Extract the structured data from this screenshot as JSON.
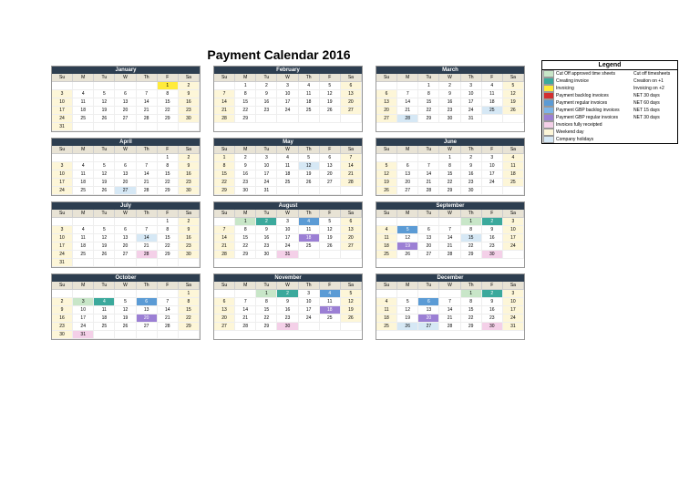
{
  "title": "Payment Calendar 2016",
  "dow": [
    "Su",
    "M",
    "Tu",
    "W",
    "Th",
    "F",
    "Sa"
  ],
  "months": [
    {
      "name": "January",
      "cells": [
        [
          "",
          "",
          "",
          "",
          "",
          "1 yl",
          "2 we"
        ],
        [
          "3 we",
          "4",
          "5",
          "6",
          "7",
          "8",
          "9 we"
        ],
        [
          "10 we",
          "11",
          "12",
          "13",
          "14",
          "15",
          "16 we"
        ],
        [
          "17 we",
          "18",
          "19",
          "20",
          "21",
          "22",
          "23 we"
        ],
        [
          "24 we",
          "25",
          "26",
          "27",
          "28",
          "29",
          "30 we"
        ],
        [
          "31 we",
          "",
          "",
          "",
          "",
          "",
          ""
        ]
      ]
    },
    {
      "name": "February",
      "cells": [
        [
          "",
          "1",
          "2",
          "3",
          "4",
          "5",
          "6 we"
        ],
        [
          "7 we",
          "8",
          "9",
          "10",
          "11",
          "12",
          "13 we"
        ],
        [
          "14 we",
          "15",
          "16",
          "17",
          "18",
          "19",
          "20 we"
        ],
        [
          "21 we",
          "22",
          "23",
          "24",
          "25",
          "26",
          "27 we"
        ],
        [
          "28 we",
          "29",
          "",
          "",
          "",
          "",
          ""
        ]
      ]
    },
    {
      "name": "March",
      "cells": [
        [
          "",
          "",
          "1",
          "2",
          "3",
          "4",
          "5 we"
        ],
        [
          "6 we",
          "7",
          "8",
          "9",
          "10",
          "11",
          "12 we"
        ],
        [
          "13 we",
          "14",
          "15",
          "16",
          "17",
          "18",
          "19 we"
        ],
        [
          "20 we",
          "21",
          "22",
          "23",
          "24",
          "25 hol",
          "26 we"
        ],
        [
          "27 we",
          "28 hol",
          "29",
          "30",
          "31",
          "",
          ""
        ]
      ]
    },
    {
      "name": "April",
      "cells": [
        [
          "",
          "",
          "",
          "",
          "",
          "1",
          "2 we"
        ],
        [
          "3 we",
          "4",
          "5",
          "6",
          "7",
          "8",
          "9 we"
        ],
        [
          "10 we",
          "11",
          "12",
          "13",
          "14",
          "15",
          "16 we"
        ],
        [
          "17 we",
          "18",
          "19",
          "20",
          "21",
          "22",
          "23 we"
        ],
        [
          "24 we",
          "25",
          "26",
          "27 hol",
          "28",
          "29",
          "30 we"
        ]
      ]
    },
    {
      "name": "May",
      "cells": [
        [
          "1 we",
          "2",
          "3",
          "4",
          "5",
          "6",
          "7 we"
        ],
        [
          "8 we",
          "9",
          "10",
          "11",
          "12 hol",
          "13",
          "14 we"
        ],
        [
          "15 we",
          "16",
          "17",
          "18",
          "19",
          "20",
          "21 we"
        ],
        [
          "22 we",
          "23",
          "24",
          "25",
          "26",
          "27",
          "28 we"
        ],
        [
          "29 we",
          "30",
          "31",
          "",
          "",
          "",
          ""
        ]
      ]
    },
    {
      "name": "June",
      "cells": [
        [
          "",
          "",
          "",
          "1",
          "2",
          "3",
          "4 we"
        ],
        [
          "5 we",
          "6",
          "7",
          "8",
          "9",
          "10",
          "11 we"
        ],
        [
          "12 we",
          "13",
          "14",
          "15",
          "16",
          "17",
          "18 we"
        ],
        [
          "19 we",
          "20",
          "21",
          "22",
          "23",
          "24",
          "25 we"
        ],
        [
          "26 we",
          "27",
          "28",
          "29",
          "30",
          "",
          ""
        ]
      ]
    },
    {
      "name": "July",
      "cells": [
        [
          "",
          "",
          "",
          "",
          "",
          "1",
          "2 we"
        ],
        [
          "3 we",
          "4",
          "5",
          "6",
          "7",
          "8",
          "9 we"
        ],
        [
          "10 we",
          "11",
          "12",
          "13",
          "14 hol",
          "15",
          "16 we"
        ],
        [
          "17 we",
          "18",
          "19",
          "20",
          "21",
          "22",
          "23 we"
        ],
        [
          "24 we",
          "25",
          "26",
          "27",
          "28 pk",
          "29",
          "30 we"
        ],
        [
          "31 we",
          "",
          "",
          "",
          "",
          "",
          ""
        ]
      ]
    },
    {
      "name": "August",
      "cells": [
        [
          "",
          "1 gr",
          "2 tl",
          "3",
          "4 bl",
          "5",
          "6 we"
        ],
        [
          "7 we",
          "8",
          "9",
          "10",
          "11",
          "12",
          "13 we"
        ],
        [
          "14 we",
          "15",
          "16",
          "17",
          "18 pu",
          "19",
          "20 we"
        ],
        [
          "21 we",
          "22",
          "23",
          "24",
          "25",
          "26",
          "27 we"
        ],
        [
          "28 we",
          "29",
          "30",
          "31 pk",
          "",
          "",
          ""
        ]
      ]
    },
    {
      "name": "September",
      "cells": [
        [
          "",
          "",
          "",
          "",
          "1 gr",
          "2 tl",
          "3 we"
        ],
        [
          "4 we",
          "5 bl",
          "6",
          "7",
          "8",
          "9",
          "10 we"
        ],
        [
          "11 we",
          "12",
          "13",
          "14",
          "15 hol",
          "16",
          "17 we"
        ],
        [
          "18 we",
          "19 pu",
          "20",
          "21",
          "22",
          "23",
          "24 we"
        ],
        [
          "25 we",
          "26",
          "27",
          "28",
          "29",
          "30 pk",
          ""
        ]
      ]
    },
    {
      "name": "October",
      "cells": [
        [
          "",
          "",
          "",
          "",
          "",
          "",
          "1 we"
        ],
        [
          "2 we",
          "3 gr",
          "4 tl",
          "5",
          "6 bl",
          "7",
          "8 we"
        ],
        [
          "9 we",
          "10",
          "11",
          "12",
          "13",
          "14",
          "15 we"
        ],
        [
          "16 we",
          "17",
          "18",
          "19",
          "20 pu",
          "21",
          "22 we"
        ],
        [
          "23 we",
          "24",
          "25",
          "26",
          "27",
          "28",
          "29 we"
        ],
        [
          "30 we",
          "31 pk",
          "",
          "",
          "",
          "",
          ""
        ]
      ]
    },
    {
      "name": "November",
      "cells": [
        [
          "",
          "",
          "1 gr",
          "2 tl",
          "3",
          "4 bl",
          "5 we"
        ],
        [
          "6 we",
          "7",
          "8",
          "9",
          "10",
          "11",
          "12 we"
        ],
        [
          "13 we",
          "14",
          "15",
          "16",
          "17",
          "18 pu",
          "19 we"
        ],
        [
          "20 we",
          "21",
          "22",
          "23",
          "24",
          "25",
          "26 we"
        ],
        [
          "27 we",
          "28",
          "29",
          "30 pk",
          "",
          "",
          ""
        ]
      ]
    },
    {
      "name": "December",
      "cells": [
        [
          "",
          "",
          "",
          "",
          "1 gr",
          "2 tl",
          "3 we"
        ],
        [
          "4 we",
          "5",
          "6 bl",
          "7",
          "8",
          "9",
          "10 we"
        ],
        [
          "11 we",
          "12",
          "13",
          "14",
          "15",
          "16",
          "17 we"
        ],
        [
          "18 we",
          "19",
          "20 pu",
          "21",
          "22",
          "23",
          "24 we"
        ],
        [
          "25 we",
          "26 hol",
          "27 hol",
          "28",
          "29",
          "30 pk",
          "31 we"
        ]
      ]
    }
  ],
  "legend": {
    "title": "Legend",
    "items": [
      {
        "c": "#c8e6c8",
        "l": "Cut Off approved time sheets",
        "r": "Cut off timesheets"
      },
      {
        "c": "#3ba99c",
        "l": "Creating invoice",
        "r": "Creation on +1"
      },
      {
        "c": "#ffeb3b",
        "l": "Invoicing",
        "r": "Invoicing on +2"
      },
      {
        "c": "#d32f2f",
        "l": "Payment backlog invoices",
        "r": "NET 30 days"
      },
      {
        "c": "#5b9bd5",
        "l": "Payment regular invoices",
        "r": "NET 60 days"
      },
      {
        "c": "#7eb6e8",
        "l": "Payment GBP backlog invoices",
        "r": "NET 15 days"
      },
      {
        "c": "#9b7fd4",
        "l": "Payment GBP regular invoices",
        "r": "NET 30 days"
      },
      {
        "c": "#f4d0e8",
        "l": "Invoices fully receipted",
        "r": ""
      },
      {
        "c": "#fdf6d8",
        "l": "Weekend day",
        "r": ""
      },
      {
        "c": "#d6e8f5",
        "l": "Company holidays",
        "r": ""
      }
    ]
  }
}
